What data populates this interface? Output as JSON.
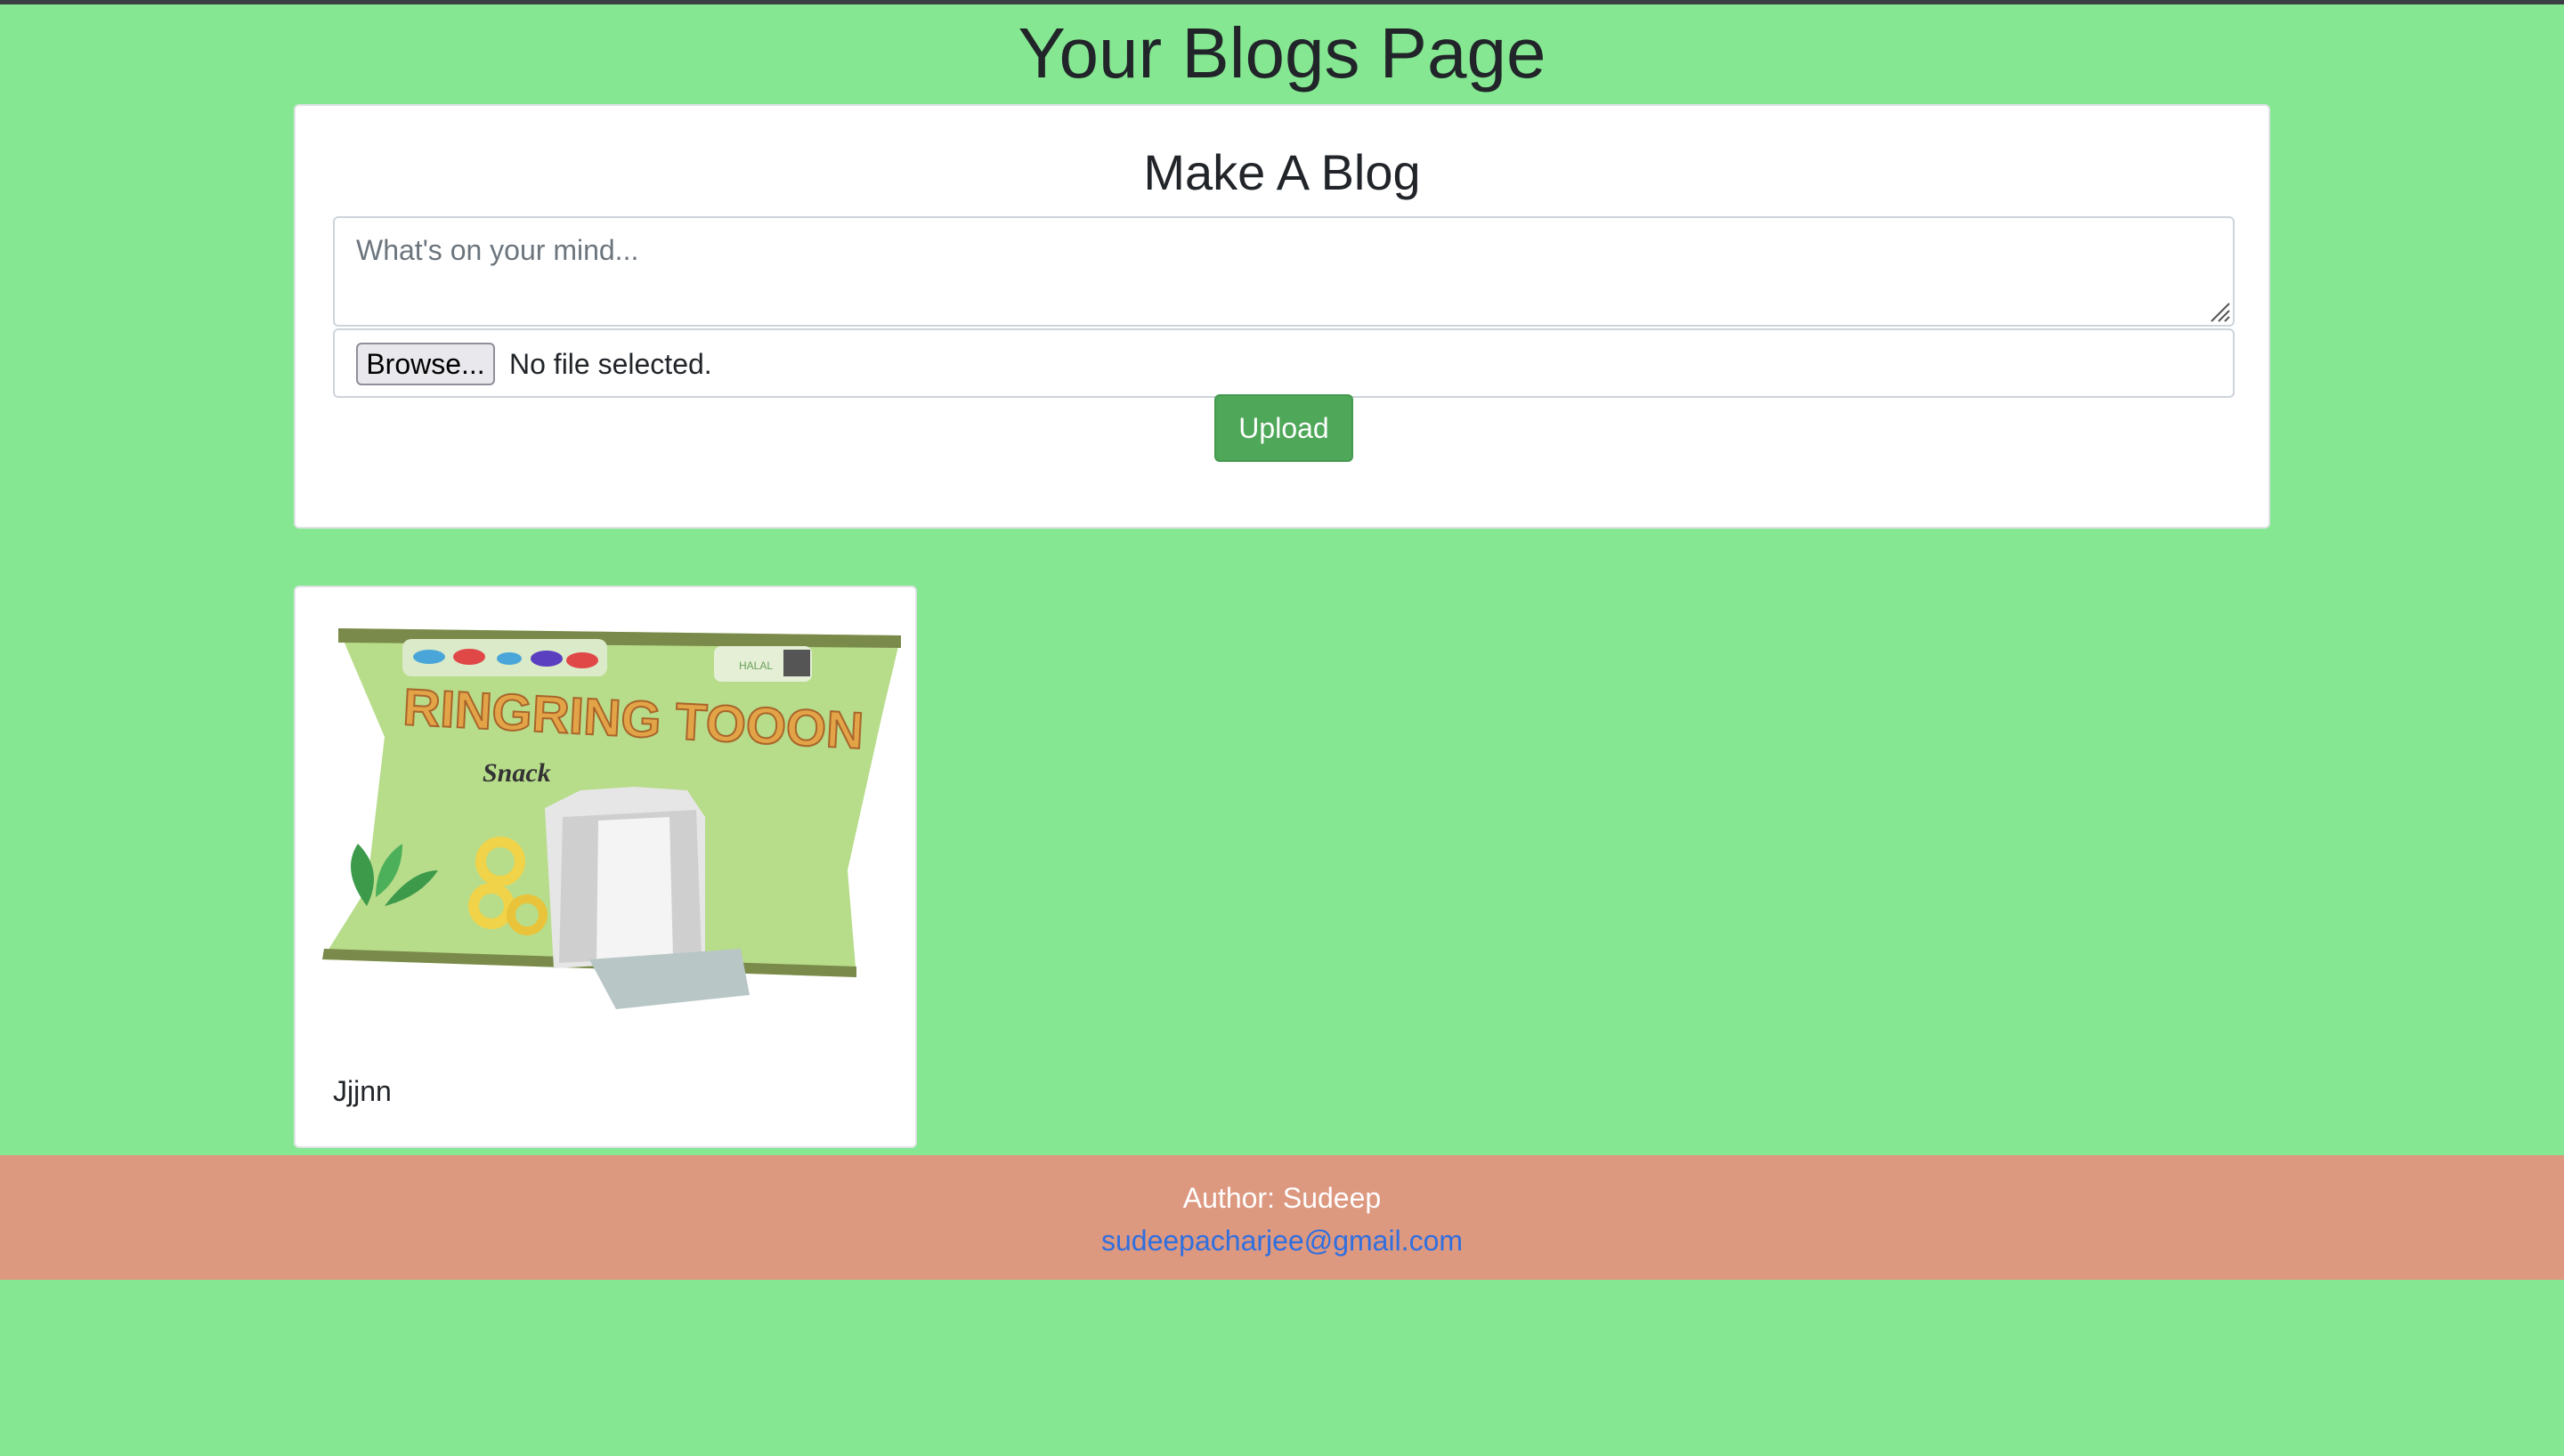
{
  "page": {
    "title": "Your Blogs Page"
  },
  "compose": {
    "title": "Make A Blog",
    "textarea_placeholder": "What's on your mind...",
    "browse_label": "Browse...",
    "file_status": "No file selected.",
    "upload_label": "Upload"
  },
  "posts": [
    {
      "image_text": "RINGRING TOOON",
      "image_subtext": "Snack",
      "image_badge": "HALAL",
      "text": "Jjjnn"
    }
  ],
  "footer": {
    "author": "Author: Sudeep",
    "email": "sudeepacharjee@gmail.com"
  },
  "colors": {
    "background": "#85e791",
    "upload_button": "#4fa759",
    "footer": "#dd9880",
    "link": "#2f6fe0"
  }
}
